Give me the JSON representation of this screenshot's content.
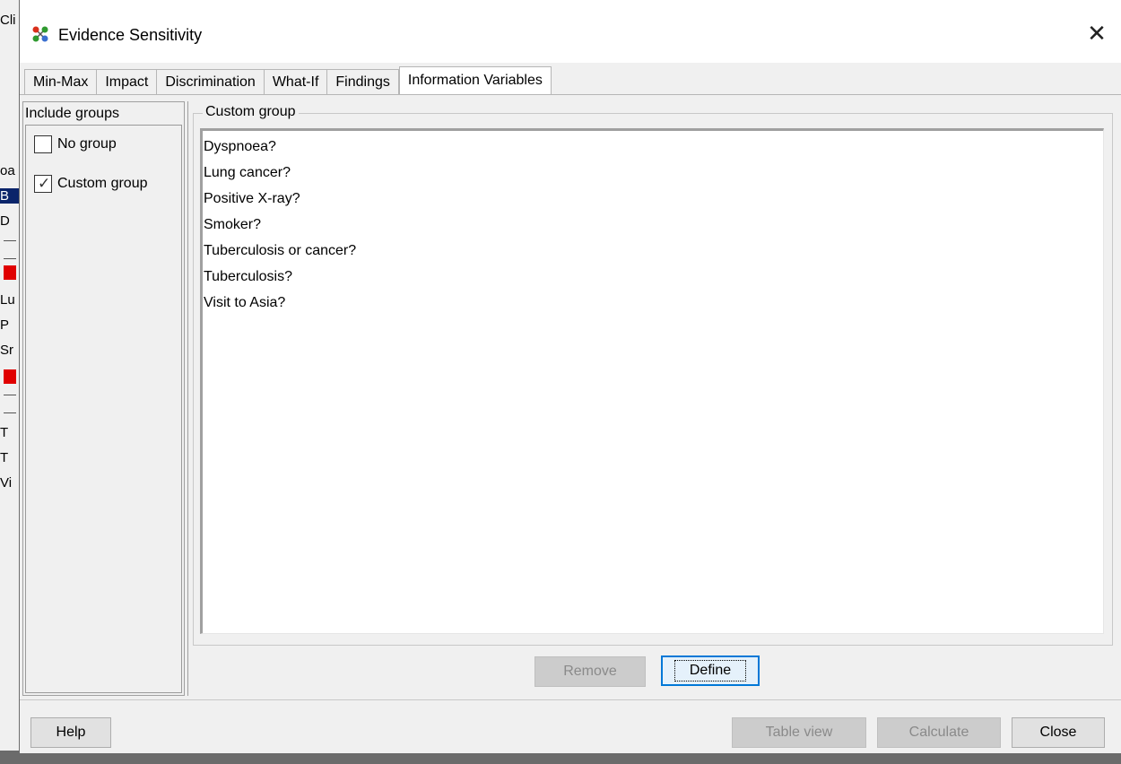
{
  "background": {
    "fragments": [
      "Cli",
      "oa",
      "B",
      "D",
      "Lu",
      "P",
      "Sr",
      "T",
      "T",
      "Vi"
    ]
  },
  "window": {
    "title": "Evidence Sensitivity",
    "icon": "network-nodes-icon",
    "close_glyph": "✕"
  },
  "tabs": [
    {
      "label": "Min-Max",
      "active": false
    },
    {
      "label": "Impact",
      "active": false
    },
    {
      "label": "Discrimination",
      "active": false
    },
    {
      "label": "What-If",
      "active": false
    },
    {
      "label": "Findings",
      "active": false
    },
    {
      "label": "Information Variables",
      "active": true
    }
  ],
  "include_groups": {
    "header": "Include groups",
    "options": [
      {
        "label": "No group",
        "checked": false
      },
      {
        "label": "Custom group",
        "checked": true
      }
    ]
  },
  "custom_group": {
    "legend": "Custom group",
    "items": [
      "Dyspnoea?",
      "Lung cancer?",
      "Positive X-ray?",
      "Smoker?",
      "Tuberculosis or cancer?",
      "Tuberculosis?",
      "Visit to Asia?"
    ],
    "remove_label": "Remove",
    "define_label": "Define"
  },
  "footer": {
    "help_label": "Help",
    "table_view_label": "Table view",
    "calculate_label": "Calculate",
    "close_label": "Close"
  },
  "colors": {
    "accent": "#0078d7",
    "selection_bg": "#0a246a",
    "marker_red": "#e00000"
  }
}
